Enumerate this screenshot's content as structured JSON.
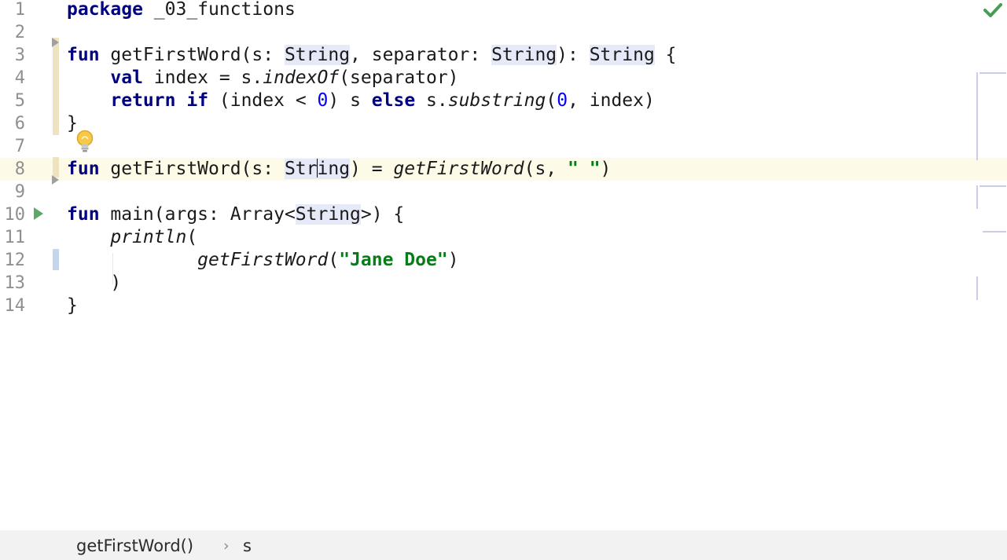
{
  "editor": {
    "line_numbers": [
      "1",
      "2",
      "3",
      "4",
      "5",
      "6",
      "7",
      "8",
      "9",
      "10",
      "11",
      "12",
      "13",
      "14"
    ],
    "lines": [
      [
        [
          "kw",
          "package"
        ],
        [
          "t",
          " _03_functions"
        ]
      ],
      [],
      [
        [
          "kw",
          "fun"
        ],
        [
          "t",
          " getFirstWord(s: "
        ],
        [
          "ty",
          "String"
        ],
        [
          "t",
          ", separator: "
        ],
        [
          "ty",
          "String"
        ],
        [
          "t",
          "): "
        ],
        [
          "ty",
          "String"
        ],
        [
          "t",
          " {"
        ]
      ],
      [
        [
          "t",
          "    "
        ],
        [
          "kw",
          "val"
        ],
        [
          "t",
          " index = s."
        ],
        [
          "fn",
          "indexOf"
        ],
        [
          "t",
          "(separator)"
        ]
      ],
      [
        [
          "t",
          "    "
        ],
        [
          "kw",
          "return"
        ],
        [
          "t",
          " "
        ],
        [
          "kw",
          "if"
        ],
        [
          "t",
          " (index < "
        ],
        [
          "num",
          "0"
        ],
        [
          "t",
          ") s "
        ],
        [
          "kw",
          "else"
        ],
        [
          "t",
          " s."
        ],
        [
          "fn",
          "substring"
        ],
        [
          "t",
          "("
        ],
        [
          "num",
          "0"
        ],
        [
          "t",
          ", index)"
        ]
      ],
      [
        [
          "t",
          "}"
        ]
      ],
      [],
      [
        [
          "kw",
          "fun"
        ],
        [
          "t",
          " getFirstWord(s: "
        ],
        [
          "ty",
          "Str"
        ],
        [
          "caret",
          ""
        ],
        [
          "ty",
          "ing"
        ],
        [
          "t",
          ") = "
        ],
        [
          "fn",
          "getFirstWord"
        ],
        [
          "t",
          "(s, "
        ],
        [
          "str",
          "\" \""
        ],
        [
          "t",
          ")"
        ]
      ],
      [],
      [
        [
          "kw",
          "fun"
        ],
        [
          "t",
          " main(args: Array<"
        ],
        [
          "ty",
          "String"
        ],
        [
          "t",
          ">) {"
        ]
      ],
      [
        [
          "t",
          "    "
        ],
        [
          "fn",
          "println"
        ],
        [
          "t",
          "("
        ]
      ],
      [
        [
          "t",
          "            "
        ],
        [
          "fn",
          "getFirstWord"
        ],
        [
          "t",
          "("
        ],
        [
          "str",
          "\"Jane Doe\""
        ],
        [
          "t",
          ")"
        ]
      ],
      [
        [
          "t",
          "    )"
        ]
      ],
      [
        [
          "t",
          "}"
        ]
      ]
    ],
    "current_line": 8,
    "inspection_status_icon": "check-icon",
    "intention_icon": "lightbulb-icon",
    "run_icon": "run-gutter-icon"
  },
  "statusbar": {
    "breadcrumbs": [
      "getFirstWord()",
      "s"
    ],
    "separator_icon": "chevron-right-icon"
  },
  "colors": {
    "keyword": "#000080",
    "string": "#067d17",
    "number": "#0000ff",
    "type_highlight": "#e6e9f7",
    "current_line": "#fdfbe8",
    "run_icon": "#59a869",
    "check_icon": "#499c54"
  }
}
